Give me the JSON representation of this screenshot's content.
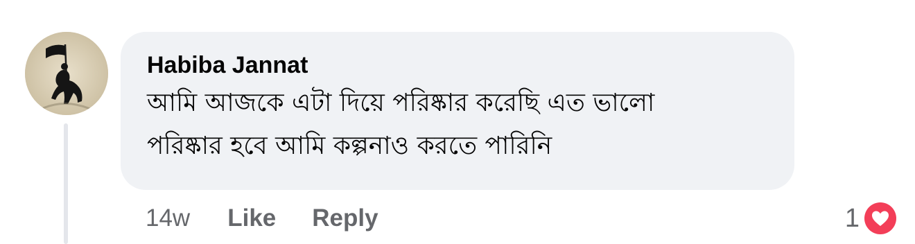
{
  "comment": {
    "author": "Habiba Jannat",
    "text_line1": "আমি আজকে এটা দিয়ে পরিষ্কার করেছি এত ভালো",
    "text_line2": "পরিষ্কার হবে আমি কল্পনাও করতে পারিনি",
    "timestamp": "14w",
    "like_label": "Like",
    "reply_label": "Reply",
    "reaction_count": "1",
    "reaction_icon": "love-icon",
    "reaction_color": "#f33e58",
    "bubble_color": "#f0f2f5"
  }
}
